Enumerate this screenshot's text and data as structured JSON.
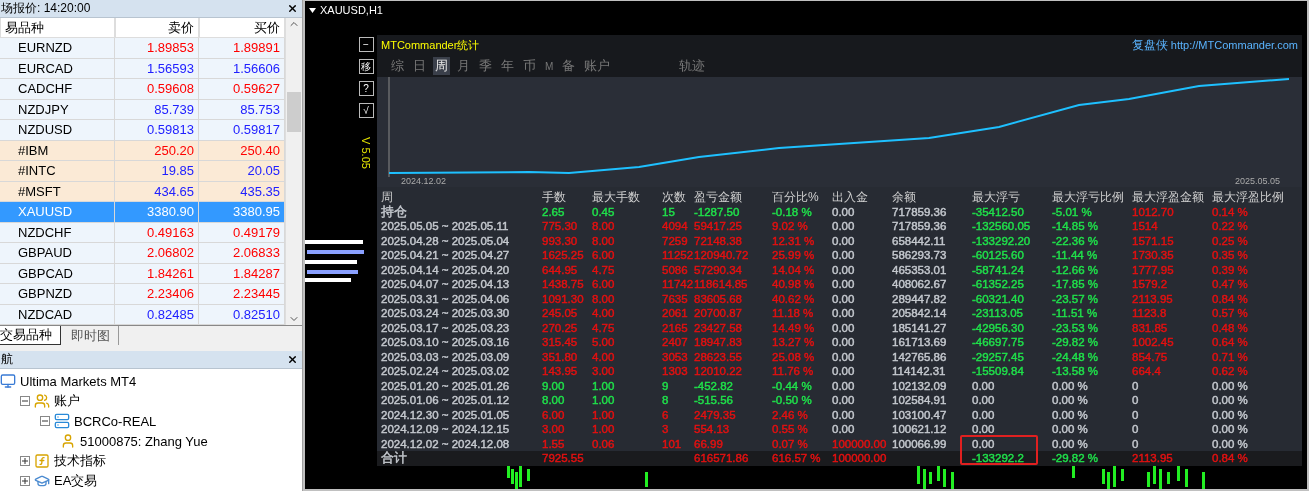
{
  "market_watch": {
    "title": "场报价: 14:20:00",
    "columns": [
      "易品种",
      "卖价",
      "买价"
    ],
    "rows": [
      {
        "symbol": "EURNZD",
        "bid": "1.89853",
        "ask": "1.89891",
        "color": "#ff0000",
        "kind": "forex",
        "selected": false
      },
      {
        "symbol": "EURCAD",
        "bid": "1.56593",
        "ask": "1.56606",
        "color": "#2020ff",
        "kind": "forex",
        "selected": false
      },
      {
        "symbol": "CADCHF",
        "bid": "0.59608",
        "ask": "0.59627",
        "color": "#ff0000",
        "kind": "forex",
        "selected": false
      },
      {
        "symbol": "NZDJPY",
        "bid": "85.739",
        "ask": "85.753",
        "color": "#2020ff",
        "kind": "forex",
        "selected": false
      },
      {
        "symbol": "NZDUSD",
        "bid": "0.59813",
        "ask": "0.59817",
        "color": "#2020ff",
        "kind": "forex",
        "selected": false
      },
      {
        "symbol": "#IBM",
        "bid": "250.20",
        "ask": "250.40",
        "color": "#ff0000",
        "kind": "stock",
        "selected": false
      },
      {
        "symbol": "#INTC",
        "bid": "19.85",
        "ask": "20.05",
        "color": "#2020ff",
        "kind": "stock",
        "selected": false
      },
      {
        "symbol": "#MSFT",
        "bid": "434.65",
        "ask": "435.35",
        "color": "#2020ff",
        "kind": "stock",
        "selected": false
      },
      {
        "symbol": "XAUUSD",
        "bid": "3380.90",
        "ask": "3380.95",
        "selected": true
      },
      {
        "symbol": "NZDCHF",
        "bid": "0.49163",
        "ask": "0.49179",
        "color": "#ff0000",
        "kind": "forex",
        "selected": false
      },
      {
        "symbol": "GBPAUD",
        "bid": "2.06802",
        "ask": "2.06833",
        "color": "#ff0000",
        "kind": "forex",
        "selected": false
      },
      {
        "symbol": "GBPCAD",
        "bid": "1.84261",
        "ask": "1.84287",
        "color": "#ff0000",
        "kind": "forex",
        "selected": false
      },
      {
        "symbol": "GBPNZD",
        "bid": "2.23406",
        "ask": "2.23445",
        "color": "#ff0000",
        "kind": "forex",
        "selected": false
      },
      {
        "symbol": "NZDCAD",
        "bid": "0.82485",
        "ask": "0.82510",
        "color": "#2020ff",
        "kind": "forex",
        "selected": false
      }
    ],
    "tabs": [
      {
        "label": "交易品种",
        "selected": true
      },
      {
        "label": "即时图",
        "selected": false
      }
    ]
  },
  "navigator": {
    "title": "航",
    "tree": [
      {
        "label": "Ultima Markets MT4",
        "kind": "terminal",
        "children": [
          {
            "label": "账户",
            "kind": "accounts",
            "expanded": true,
            "children": [
              {
                "label": "BCRCo-REAL",
                "kind": "server",
                "expanded": true,
                "children": [
                  {
                    "label": "51000875: Zhang Yue",
                    "kind": "user"
                  }
                ]
              }
            ]
          },
          {
            "label": "技术指标",
            "kind": "indicators",
            "expanded": false
          },
          {
            "label": "EA交易",
            "kind": "experts",
            "expanded": false
          }
        ]
      }
    ]
  },
  "chart": {
    "title": "XAUUSD,H1",
    "side_buttons": [
      "−",
      "移",
      "?",
      "√"
    ],
    "version": "V 5.05",
    "panel": {
      "title": "MTCommander统计",
      "brand": "复盘侠",
      "link": "http://MTCommander.com",
      "tabs": [
        {
          "label": "综",
          "selected": false
        },
        {
          "label": "日",
          "selected": false
        },
        {
          "label": "周",
          "selected": true
        },
        {
          "label": "月",
          "selected": false
        },
        {
          "label": "季",
          "selected": false
        },
        {
          "label": "年",
          "selected": false
        },
        {
          "label": "币",
          "selected": false
        },
        {
          "label": "M",
          "selected": false
        },
        {
          "label": "备",
          "selected": false
        },
        {
          "label": "账户",
          "selected": false
        }
      ],
      "tools": [
        {
          "label": "轨迹",
          "selected": false
        }
      ],
      "curve": {
        "start_date": "2024.12.02",
        "end_date": "2025.05.05"
      },
      "columns": [
        "周",
        "手数",
        "最大手数",
        "次数",
        "盈亏金额",
        "百分比%",
        "出入金",
        "余额",
        "最大浮亏",
        "最大浮亏比例",
        "最大浮盈金额",
        "最大浮盈比例"
      ],
      "rows": [
        {
          "kind": "open",
          "cells": [
            {
              "text": "持仓",
              "color": "#c4c8ce"
            },
            {
              "text": "2.65",
              "color": "#1fe04a"
            },
            {
              "text": "0.45",
              "color": "#1fe04a"
            },
            {
              "text": "15",
              "color": "#1fe04a"
            },
            {
              "text": "-1287.50",
              "color": "#1fe04a"
            },
            {
              "text": "-0.18 %",
              "color": "#1fe04a"
            },
            {
              "text": "0.00",
              "color": "#c4c8ce"
            },
            {
              "text": "717859.36",
              "color": "#c4c8ce"
            },
            {
              "text": "-35412.50",
              "color": "#1fe04a"
            },
            {
              "text": "-5.01 %",
              "color": "#1fe04a"
            },
            {
              "text": "1012.70",
              "color": "#e41010"
            },
            {
              "text": "0.14 %",
              "color": "#e41010"
            }
          ]
        },
        {
          "kind": "week",
          "cells": [
            {
              "text": "2025.05.05 ~ 2025.05.11",
              "color": "#c4c8ce"
            },
            {
              "text": "775.30",
              "color": "#e41010"
            },
            {
              "text": "8.00",
              "color": "#e41010"
            },
            {
              "text": "4094",
              "color": "#e41010"
            },
            {
              "text": "59417.25",
              "color": "#e41010"
            },
            {
              "text": "9.02 %",
              "color": "#e41010"
            },
            {
              "text": "0.00",
              "color": "#c4c8ce"
            },
            {
              "text": "717859.36",
              "color": "#c4c8ce"
            },
            {
              "text": "-132560.05",
              "color": "#1fe04a"
            },
            {
              "text": "-14.85 %",
              "color": "#1fe04a"
            },
            {
              "text": "1514",
              "color": "#e41010"
            },
            {
              "text": "0.22 %",
              "color": "#e41010"
            }
          ]
        },
        {
          "kind": "week",
          "cells": [
            {
              "text": "2025.04.28 ~ 2025.05.04",
              "color": "#c4c8ce"
            },
            {
              "text": "993.30",
              "color": "#e41010"
            },
            {
              "text": "8.00",
              "color": "#e41010"
            },
            {
              "text": "7259",
              "color": "#e41010"
            },
            {
              "text": "72148.38",
              "color": "#e41010"
            },
            {
              "text": "12.31 %",
              "color": "#e41010"
            },
            {
              "text": "0.00",
              "color": "#c4c8ce"
            },
            {
              "text": "658442.11",
              "color": "#c4c8ce"
            },
            {
              "text": "-133292.20",
              "color": "#1fe04a"
            },
            {
              "text": "-22.36 %",
              "color": "#1fe04a"
            },
            {
              "text": "1571.15",
              "color": "#e41010"
            },
            {
              "text": "0.25 %",
              "color": "#e41010"
            }
          ]
        },
        {
          "kind": "week",
          "cells": [
            {
              "text": "2025.04.21 ~ 2025.04.27",
              "color": "#c4c8ce"
            },
            {
              "text": "1625.25",
              "color": "#e41010"
            },
            {
              "text": "6.00",
              "color": "#e41010"
            },
            {
              "text": "11252",
              "color": "#e41010"
            },
            {
              "text": "120940.72",
              "color": "#e41010"
            },
            {
              "text": "25.99 %",
              "color": "#e41010"
            },
            {
              "text": "0.00",
              "color": "#c4c8ce"
            },
            {
              "text": "586293.73",
              "color": "#c4c8ce"
            },
            {
              "text": "-60125.60",
              "color": "#1fe04a"
            },
            {
              "text": "-11.44 %",
              "color": "#1fe04a"
            },
            {
              "text": "1730.35",
              "color": "#e41010"
            },
            {
              "text": "0.35 %",
              "color": "#e41010"
            }
          ]
        },
        {
          "kind": "week",
          "cells": [
            {
              "text": "2025.04.14 ~ 2025.04.20",
              "color": "#c4c8ce"
            },
            {
              "text": "644.95",
              "color": "#e41010"
            },
            {
              "text": "4.75",
              "color": "#e41010"
            },
            {
              "text": "5086",
              "color": "#e41010"
            },
            {
              "text": "57290.34",
              "color": "#e41010"
            },
            {
              "text": "14.04 %",
              "color": "#e41010"
            },
            {
              "text": "0.00",
              "color": "#c4c8ce"
            },
            {
              "text": "465353.01",
              "color": "#c4c8ce"
            },
            {
              "text": "-58741.24",
              "color": "#1fe04a"
            },
            {
              "text": "-12.66 %",
              "color": "#1fe04a"
            },
            {
              "text": "1777.95",
              "color": "#e41010"
            },
            {
              "text": "0.39 %",
              "color": "#e41010"
            }
          ]
        },
        {
          "kind": "week",
          "cells": [
            {
              "text": "2025.04.07 ~ 2025.04.13",
              "color": "#c4c8ce"
            },
            {
              "text": "1438.75",
              "color": "#e41010"
            },
            {
              "text": "6.00",
              "color": "#e41010"
            },
            {
              "text": "11742",
              "color": "#e41010"
            },
            {
              "text": "118614.85",
              "color": "#e41010"
            },
            {
              "text": "40.98 %",
              "color": "#e41010"
            },
            {
              "text": "0.00",
              "color": "#c4c8ce"
            },
            {
              "text": "408062.67",
              "color": "#c4c8ce"
            },
            {
              "text": "-61352.25",
              "color": "#1fe04a"
            },
            {
              "text": "-17.85 %",
              "color": "#1fe04a"
            },
            {
              "text": "1579.2",
              "color": "#e41010"
            },
            {
              "text": "0.47 %",
              "color": "#e41010"
            }
          ]
        },
        {
          "kind": "week",
          "cells": [
            {
              "text": "2025.03.31 ~ 2025.04.06",
              "color": "#c4c8ce"
            },
            {
              "text": "1091.30",
              "color": "#e41010"
            },
            {
              "text": "8.00",
              "color": "#e41010"
            },
            {
              "text": "7635",
              "color": "#e41010"
            },
            {
              "text": "83605.68",
              "color": "#e41010"
            },
            {
              "text": "40.62 %",
              "color": "#e41010"
            },
            {
              "text": "0.00",
              "color": "#c4c8ce"
            },
            {
              "text": "289447.82",
              "color": "#c4c8ce"
            },
            {
              "text": "-60321.40",
              "color": "#1fe04a"
            },
            {
              "text": "-23.57 %",
              "color": "#1fe04a"
            },
            {
              "text": "2113.95",
              "color": "#e41010"
            },
            {
              "text": "0.84 %",
              "color": "#e41010"
            }
          ]
        },
        {
          "kind": "week",
          "cells": [
            {
              "text": "2025.03.24 ~ 2025.03.30",
              "color": "#c4c8ce"
            },
            {
              "text": "245.05",
              "color": "#e41010"
            },
            {
              "text": "4.00",
              "color": "#e41010"
            },
            {
              "text": "2061",
              "color": "#e41010"
            },
            {
              "text": "20700.87",
              "color": "#e41010"
            },
            {
              "text": "11.18 %",
              "color": "#e41010"
            },
            {
              "text": "0.00",
              "color": "#c4c8ce"
            },
            {
              "text": "205842.14",
              "color": "#c4c8ce"
            },
            {
              "text": "-23113.05",
              "color": "#1fe04a"
            },
            {
              "text": "-11.51 %",
              "color": "#1fe04a"
            },
            {
              "text": "1123.8",
              "color": "#e41010"
            },
            {
              "text": "0.57 %",
              "color": "#e41010"
            }
          ]
        },
        {
          "kind": "week",
          "cells": [
            {
              "text": "2025.03.17 ~ 2025.03.23",
              "color": "#c4c8ce"
            },
            {
              "text": "270.25",
              "color": "#e41010"
            },
            {
              "text": "4.75",
              "color": "#e41010"
            },
            {
              "text": "2165",
              "color": "#e41010"
            },
            {
              "text": "23427.58",
              "color": "#e41010"
            },
            {
              "text": "14.49 %",
              "color": "#e41010"
            },
            {
              "text": "0.00",
              "color": "#c4c8ce"
            },
            {
              "text": "185141.27",
              "color": "#c4c8ce"
            },
            {
              "text": "-42956.30",
              "color": "#1fe04a"
            },
            {
              "text": "-23.53 %",
              "color": "#1fe04a"
            },
            {
              "text": "831.85",
              "color": "#e41010"
            },
            {
              "text": "0.48 %",
              "color": "#e41010"
            }
          ]
        },
        {
          "kind": "week",
          "cells": [
            {
              "text": "2025.03.10 ~ 2025.03.16",
              "color": "#c4c8ce"
            },
            {
              "text": "315.45",
              "color": "#e41010"
            },
            {
              "text": "5.00",
              "color": "#e41010"
            },
            {
              "text": "2407",
              "color": "#e41010"
            },
            {
              "text": "18947.83",
              "color": "#e41010"
            },
            {
              "text": "13.27 %",
              "color": "#e41010"
            },
            {
              "text": "0.00",
              "color": "#c4c8ce"
            },
            {
              "text": "161713.69",
              "color": "#c4c8ce"
            },
            {
              "text": "-46697.75",
              "color": "#1fe04a"
            },
            {
              "text": "-29.82 %",
              "color": "#1fe04a"
            },
            {
              "text": "1002.45",
              "color": "#e41010"
            },
            {
              "text": "0.64 %",
              "color": "#e41010"
            }
          ]
        },
        {
          "kind": "week",
          "cells": [
            {
              "text": "2025.03.03 ~ 2025.03.09",
              "color": "#c4c8ce"
            },
            {
              "text": "351.80",
              "color": "#e41010"
            },
            {
              "text": "4.00",
              "color": "#e41010"
            },
            {
              "text": "3053",
              "color": "#e41010"
            },
            {
              "text": "28623.55",
              "color": "#e41010"
            },
            {
              "text": "25.08 %",
              "color": "#e41010"
            },
            {
              "text": "0.00",
              "color": "#c4c8ce"
            },
            {
              "text": "142765.86",
              "color": "#c4c8ce"
            },
            {
              "text": "-29257.45",
              "color": "#1fe04a"
            },
            {
              "text": "-24.48 %",
              "color": "#1fe04a"
            },
            {
              "text": "854.75",
              "color": "#e41010"
            },
            {
              "text": "0.71 %",
              "color": "#e41010"
            }
          ]
        },
        {
          "kind": "week",
          "cells": [
            {
              "text": "2025.02.24 ~ 2025.03.02",
              "color": "#c4c8ce"
            },
            {
              "text": "143.95",
              "color": "#e41010"
            },
            {
              "text": "3.00",
              "color": "#e41010"
            },
            {
              "text": "1303",
              "color": "#e41010"
            },
            {
              "text": "12010.22",
              "color": "#e41010"
            },
            {
              "text": "11.76 %",
              "color": "#e41010"
            },
            {
              "text": "0.00",
              "color": "#c4c8ce"
            },
            {
              "text": "114142.31",
              "color": "#c4c8ce"
            },
            {
              "text": "-15509.84",
              "color": "#1fe04a"
            },
            {
              "text": "-13.58 %",
              "color": "#1fe04a"
            },
            {
              "text": "664.4",
              "color": "#e41010"
            },
            {
              "text": "0.62 %",
              "color": "#e41010"
            }
          ]
        },
        {
          "kind": "week",
          "cells": [
            {
              "text": "2025.01.20 ~ 2025.01.26",
              "color": "#c4c8ce"
            },
            {
              "text": "9.00",
              "color": "#1fe04a"
            },
            {
              "text": "1.00",
              "color": "#1fe04a"
            },
            {
              "text": "9",
              "color": "#1fe04a"
            },
            {
              "text": "-452.82",
              "color": "#1fe04a"
            },
            {
              "text": "-0.44 %",
              "color": "#1fe04a"
            },
            {
              "text": "0.00",
              "color": "#c4c8ce"
            },
            {
              "text": "102132.09",
              "color": "#c4c8ce"
            },
            {
              "text": "0.00",
              "color": "#c4c8ce"
            },
            {
              "text": "0.00 %",
              "color": "#c4c8ce"
            },
            {
              "text": "0",
              "color": "#c4c8ce"
            },
            {
              "text": "0.00 %",
              "color": "#c4c8ce"
            }
          ]
        },
        {
          "kind": "week",
          "cells": [
            {
              "text": "2025.01.06 ~ 2025.01.12",
              "color": "#c4c8ce"
            },
            {
              "text": "8.00",
              "color": "#1fe04a"
            },
            {
              "text": "1.00",
              "color": "#1fe04a"
            },
            {
              "text": "8",
              "color": "#1fe04a"
            },
            {
              "text": "-515.56",
              "color": "#1fe04a"
            },
            {
              "text": "-0.50 %",
              "color": "#1fe04a"
            },
            {
              "text": "0.00",
              "color": "#c4c8ce"
            },
            {
              "text": "102584.91",
              "color": "#c4c8ce"
            },
            {
              "text": "0.00",
              "color": "#c4c8ce"
            },
            {
              "text": "0.00 %",
              "color": "#c4c8ce"
            },
            {
              "text": "0",
              "color": "#c4c8ce"
            },
            {
              "text": "0.00 %",
              "color": "#c4c8ce"
            }
          ]
        },
        {
          "kind": "week",
          "cells": [
            {
              "text": "2024.12.30 ~ 2025.01.05",
              "color": "#c4c8ce"
            },
            {
              "text": "6.00",
              "color": "#e41010"
            },
            {
              "text": "1.00",
              "color": "#e41010"
            },
            {
              "text": "6",
              "color": "#e41010"
            },
            {
              "text": "2479.35",
              "color": "#e41010"
            },
            {
              "text": "2.46 %",
              "color": "#e41010"
            },
            {
              "text": "0.00",
              "color": "#c4c8ce"
            },
            {
              "text": "103100.47",
              "color": "#c4c8ce"
            },
            {
              "text": "0.00",
              "color": "#c4c8ce"
            },
            {
              "text": "0.00 %",
              "color": "#c4c8ce"
            },
            {
              "text": "0",
              "color": "#c4c8ce"
            },
            {
              "text": "0.00 %",
              "color": "#c4c8ce"
            }
          ]
        },
        {
          "kind": "week",
          "cells": [
            {
              "text": "2024.12.09 ~ 2024.12.15",
              "color": "#c4c8ce"
            },
            {
              "text": "3.00",
              "color": "#e41010"
            },
            {
              "text": "1.00",
              "color": "#e41010"
            },
            {
              "text": "3",
              "color": "#e41010"
            },
            {
              "text": "554.13",
              "color": "#e41010"
            },
            {
              "text": "0.55 %",
              "color": "#e41010"
            },
            {
              "text": "0.00",
              "color": "#c4c8ce"
            },
            {
              "text": "100621.12",
              "color": "#c4c8ce"
            },
            {
              "text": "0.00",
              "color": "#c4c8ce"
            },
            {
              "text": "0.00 %",
              "color": "#c4c8ce"
            },
            {
              "text": "0",
              "color": "#c4c8ce"
            },
            {
              "text": "0.00 %",
              "color": "#c4c8ce"
            }
          ]
        },
        {
          "kind": "week",
          "cells": [
            {
              "text": "2024.12.02 ~ 2024.12.08",
              "color": "#c4c8ce"
            },
            {
              "text": "1.55",
              "color": "#e41010"
            },
            {
              "text": "0.06",
              "color": "#e41010"
            },
            {
              "text": "101",
              "color": "#e41010"
            },
            {
              "text": "66.99",
              "color": "#e41010"
            },
            {
              "text": "0.07 %",
              "color": "#e41010"
            },
            {
              "text": "100000.00",
              "color": "#e41010"
            },
            {
              "text": "100066.99",
              "color": "#c4c8ce"
            },
            {
              "text": "0.00",
              "color": "#c4c8ce"
            },
            {
              "text": "0.00 %",
              "color": "#c4c8ce"
            },
            {
              "text": "0",
              "color": "#c4c8ce"
            },
            {
              "text": "0.00 %",
              "color": "#c4c8ce"
            }
          ]
        },
        {
          "kind": "total",
          "cells": [
            {
              "text": "合计",
              "color": "#c4c8ce"
            },
            {
              "text": "7925.55",
              "color": "#e41010"
            },
            null,
            null,
            {
              "text": "616571.86",
              "color": "#e41010"
            },
            {
              "text": "616.57 %",
              "color": "#e41010"
            },
            {
              "text": "100000.00",
              "color": "#e41010"
            },
            null,
            {
              "text": "-133292.2",
              "color": "#1fe04a",
              "highlighted": true
            },
            {
              "text": "-29.82 %",
              "color": "#1fe04a"
            },
            {
              "text": "2113.95",
              "color": "#e41010"
            },
            {
              "text": "0.84 %",
              "color": "#e41010"
            }
          ]
        }
      ]
    }
  }
}
